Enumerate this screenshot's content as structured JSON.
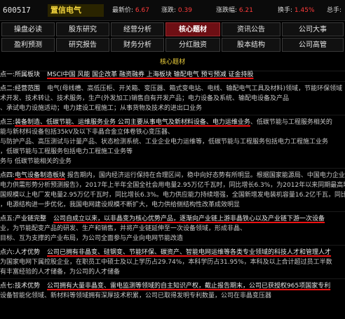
{
  "header": {
    "code": "600517",
    "name": "置信电气",
    "price_label": "最新价:",
    "price": "6.67",
    "change_label": "涨跌:",
    "change": "0.39",
    "pct_label": "涨跌幅:",
    "pct": "6.21",
    "turnover_label": "换手:",
    "turnover": "1.45%",
    "total_label": "总手:"
  },
  "tabs": [
    "操盘必读",
    "股东研究",
    "经营分析",
    "核心题材",
    "资讯公告",
    "公司大事",
    "盈利预测",
    "研究报告",
    "财务分析",
    "分红融资",
    "股本结构",
    "公司高管"
  ],
  "content": {
    "title": "核心题材",
    "rows": [
      {
        "h": "点一:所属板块",
        "hl": "MSCI中国 风能 国企改革 融资融券 上海板块 输配电气 预亏预减 证金持股",
        "c": ""
      },
      {
        "h": "点二:经营范围",
        "hl": "",
        "c": "电气(母线槽、高低压柜、开关箱、变压器、箱式变电站、电线、输配电气工具及材料)领域，节能环保领域"
      },
      {
        "h": "",
        "hl": "",
        "c": "术开发、技术转让、技术服务，生产(外发加工)销售自有开发产品；电力设备及系统、输配电设备及产品"
      },
      {
        "h": "",
        "hl": "",
        "c": "、承试电力设施适动；电力建设工程施工；从事货物及技术的进出口业务"
      },
      {
        "h": "点三:",
        "hl": "装备制造、低碳节能、运维服务业务 公司主要从事电气及新材料设备、电力运维业务",
        "c": "、低碳节能与工程服务相关的"
      },
      {
        "h": "",
        "hl": "",
        "c": "能与新材料设备包括35kV及以下非晶合金立体卷铁心变压器、"
      },
      {
        "h": "",
        "hl": "",
        "c": "与防护产品、高压测试与计量产品、状态检测系统、工业企业电力运维等，低碳节能与工程服务包括电力工程施工业务"
      },
      {
        "h": "",
        "hl": "",
        "c": "，低碳节能与工程服务包括电力工程施工业务等"
      },
      {
        "h": "",
        "hl": "",
        "c": "务与 低碳节能相关的业务"
      },
      {
        "h": "点四:",
        "hl": "电气设备制造板块",
        "c": " 报告期内，国内经济运行保持在合理区间，稳中向好态势有所明显。根据国家能源局、中国电力企业"
      },
      {
        "h": "",
        "hl": "",
        "c": "电力供需形势分析预测报告》，2017年上半年全国全社会用电量2.95万亿千瓦时，同比增长6.3%，为2012年以来同期最高增长水平"
      },
      {
        "h": "",
        "hl": "",
        "c": "国规模以上电厂发电量2.95万亿千瓦时，同比增长6.3%。电力供应能力持续增强，全国新增发电装机容量16.2亿千瓦，同比增长6.9%"
      },
      {
        "h": "",
        "hl": "",
        "c": "，电源结构进一步优化，我国电网建设规模不断扩大，电力供给侧结构性改革成效明显"
      },
      {
        "h": "点五:产业链完整",
        "hl": "公司自成立以来，以非晶变为核心优势产品，逐渐向产业链上游非晶铁心以及产业链下游一次设备",
        "c": ""
      },
      {
        "h": "",
        "hl": "",
        "c": "业，为节能配变产品的研发、生产和销售，并将产业链延伸至一次设备领域，形成非晶、"
      },
      {
        "h": "",
        "hl": "",
        "c": "目标、互为支撑的产业布局，为公司全面参与产业向电网节能改造"
      },
      {
        "h": "点六:人才优势",
        "hl": "公司已拥有非晶变、硅钢变、节能环保、碳资产、智能电网运维等各类专业领域的科技人才和管理人才",
        "c": ""
      },
      {
        "h": "",
        "hl": "",
        "c": "为国家电网下属控股企业，在职员工中硕士及以上学历占29.74%，本科学历占31.95%，本科及以上合计超过员工半数"
      },
      {
        "h": "",
        "hl": "",
        "c": "有丰富经验的人才储备，为公司的人才储备"
      },
      {
        "h": "点七:技术优势",
        "hl": "公司拥有大量非晶变、雷电监测等领域的自主知识产权，截止报告期末，公司已获授权965项国家专利",
        "c": ""
      },
      {
        "h": "",
        "hl": "",
        "c": "设备智能化领域、新材料等领域拥有深厚技术积累，公司已取得发明专利数量，公司在非晶变压器"
      }
    ]
  }
}
